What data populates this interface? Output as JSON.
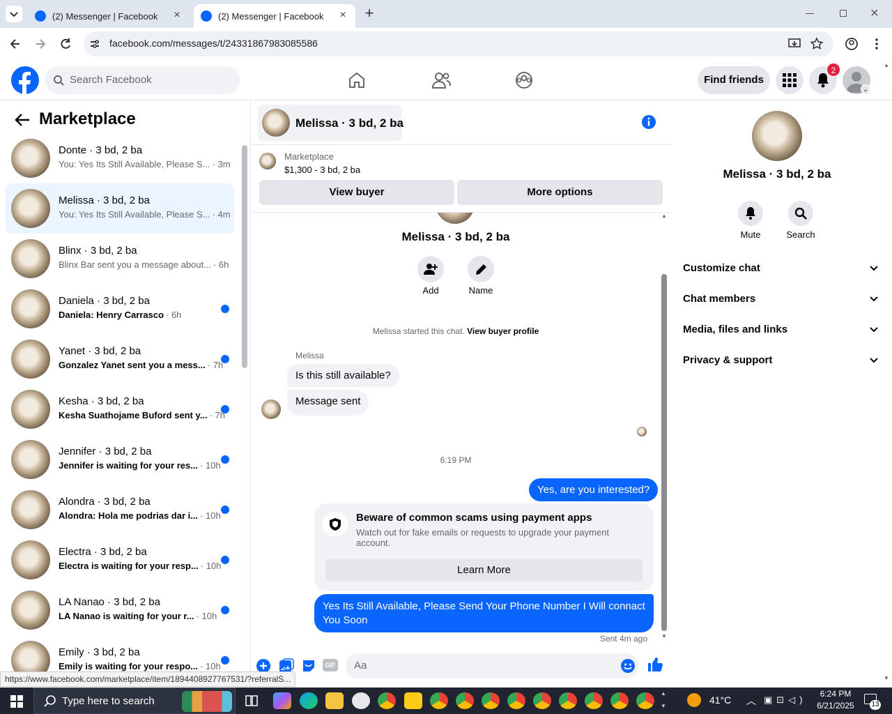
{
  "browser": {
    "tabs": [
      {
        "title": "(2) Messenger | Facebook",
        "active": false
      },
      {
        "title": "(2) Messenger | Facebook",
        "active": true
      }
    ],
    "url": "facebook.com/messages/t/24331867983085586"
  },
  "fb_nav": {
    "search_placeholder": "Search Facebook",
    "find_friends": "Find friends",
    "notification_count": "2"
  },
  "sidebar": {
    "title": "Marketplace",
    "conversations": [
      {
        "name": "Donte · 3 bd, 2 ba",
        "snippet": "You: Yes Its Still Available, Please S...",
        "time": "· 3m",
        "unread": false,
        "active": false
      },
      {
        "name": "Melissa · 3 bd, 2 ba",
        "snippet": "You: Yes Its Still Available, Please S...",
        "time": "· 4m",
        "unread": false,
        "active": true
      },
      {
        "name": "Blinx · 3 bd, 2 ba",
        "snippet": "Blinx Bar sent you a message about...",
        "time": "· 6h",
        "unread": false,
        "active": false
      },
      {
        "name": "Daniela · 3 bd, 2 ba",
        "snippet": "Daniela: Henry Carrasco",
        "time": "· 6h",
        "unread": true,
        "active": false
      },
      {
        "name": "Yanet · 3 bd, 2 ba",
        "snippet": "Gonzalez Yanet sent you a mess...",
        "time": "· 7h",
        "unread": true,
        "active": false
      },
      {
        "name": "Kesha · 3 bd, 2 ba",
        "snippet": "Kesha Suathojame Buford sent y...",
        "time": "· 7h",
        "unread": true,
        "active": false
      },
      {
        "name": "Jennifer · 3 bd, 2 ba",
        "snippet": "Jennifer is waiting for your res...",
        "time": "· 10h",
        "unread": true,
        "active": false
      },
      {
        "name": "Alondra · 3 bd, 2 ba",
        "snippet": "Alondra: Hola me podrias dar i...",
        "time": "· 10h",
        "unread": true,
        "active": false
      },
      {
        "name": "Electra · 3 bd, 2 ba",
        "snippet": "Electra is waiting for your resp...",
        "time": "· 10h",
        "unread": true,
        "active": false
      },
      {
        "name": "LA Nanao · 3 bd, 2 ba",
        "snippet": "LA Nanao is waiting for your r...",
        "time": "· 10h",
        "unread": true,
        "active": false
      },
      {
        "name": "Emily · 3 bd, 2 ba",
        "snippet": "Emily is waiting for your respo...",
        "time": "· 10h",
        "unread": true,
        "active": false
      }
    ]
  },
  "chat": {
    "header_title": "Melissa · 3 bd, 2 ba",
    "marketplace_label": "Marketplace",
    "listing": "$1,300 - 3 bd, 2 ba",
    "view_buyer": "View buyer",
    "more_options": "More options",
    "profile_name": "Melissa · 3 bd, 2 ba",
    "add_label": "Add",
    "name_label": "Name",
    "started_text": "Melissa started this chat.",
    "view_buyer_profile": "View buyer profile",
    "sender_name": "Melissa",
    "msg1": "Is this still available?",
    "msg2": "Message sent",
    "timestamp": "6:19 PM",
    "msg3": "Yes, are you interested?",
    "warning_title": "Beware of common scams using payment apps",
    "warning_body": "Watch out for fake emails or requests to upgrade your payment account.",
    "learn_more": "Learn More",
    "msg4_line1": "Yes Its Still Available, Please Send Your Phone Number I Will connact",
    "msg4_line2": "You Soon",
    "sent_status": "Sent 4m ago",
    "composer_placeholder": "Aa",
    "gif_label": "GIF"
  },
  "details": {
    "name": "Melissa · 3 bd, 2 ba",
    "mute": "Mute",
    "search": "Search",
    "sections": [
      "Customize chat",
      "Chat members",
      "Media, files and links",
      "Privacy & support"
    ]
  },
  "status_url": "https://www.facebook.com/marketplace/item/1894408927767531/?referralS...",
  "taskbar": {
    "search_placeholder": "Type here to search",
    "weather": "41°C",
    "time": "6:24 PM",
    "date": "6/21/2025",
    "notification_count": "13"
  },
  "colors": {
    "brand": "#0866ff",
    "accent_bg": "#ebf5ff",
    "bubble_in": "#f0f2f5",
    "taskbar": "#1f2430"
  }
}
